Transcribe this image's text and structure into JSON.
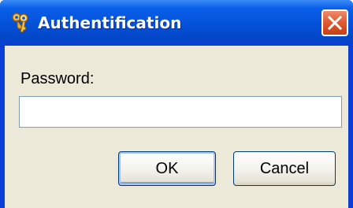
{
  "window": {
    "title": "Authentification",
    "title_icon": "keys-icon",
    "close_icon": "close-icon"
  },
  "form": {
    "password_label": "Password:",
    "password_value": ""
  },
  "buttons": {
    "ok_label": "OK",
    "cancel_label": "Cancel"
  },
  "colors": {
    "titlebar": "#0450d8",
    "client_background": "#ece9d8",
    "close_button": "#e25c33"
  }
}
